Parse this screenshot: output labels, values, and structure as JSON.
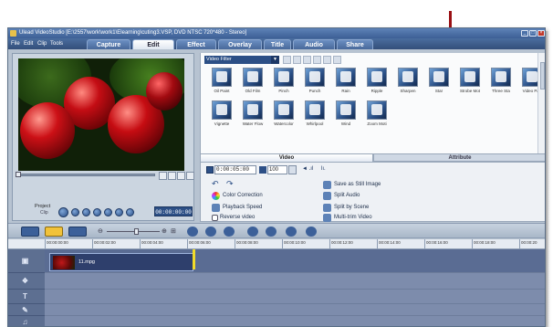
{
  "window": {
    "title": "Ulead VideoStudio [E:\\2557\\work\\work1\\Elearning\\cuting3.VSP, DVD NTSC 720*480 - Stereo]"
  },
  "menu": {
    "items": [
      "File",
      "Edit",
      "Clip",
      "Tools"
    ]
  },
  "steps": {
    "tabs": [
      "Capture",
      "Edit",
      "Effect",
      "Overlay",
      "Title",
      "Audio",
      "Share"
    ],
    "active": "Edit"
  },
  "preview": {
    "project_label": "Project",
    "clip_label": "Clip",
    "timecode": "00:00:00:00"
  },
  "library": {
    "dropdown_value": "Video Filter",
    "filters_row1": [
      "Oil Paint",
      "Old Film",
      "Pinch",
      "Punch",
      "Rain",
      "Ripple",
      "Sharpen",
      "Star",
      "Strobe Mot",
      "Three Sta",
      "Video Pan"
    ],
    "filters_row2": [
      "Vignette",
      "Water Flow",
      "Watercolor",
      "Whirlpool",
      "Wind",
      "Zoom Moti"
    ]
  },
  "options": {
    "tabs": [
      "Video",
      "Attribute"
    ],
    "duration": "0:00:05:00",
    "volume": "100",
    "left_items": [
      "Color Correction",
      "Playback Speed",
      "Reverse video"
    ],
    "right_items": [
      "Save as Still Image",
      "Split Audio",
      "Split by Scene",
      "Multi-trim Video"
    ]
  },
  "timeline": {
    "ruler_ticks": [
      "00:00:00:00",
      "00:00:02:00",
      "00:00:04:00",
      "00:00:06:00",
      "00:00:08:00",
      "00:00:10:00",
      "00:00:12:00",
      "00:00:14:00",
      "00:00:16:00",
      "00:00:18:00",
      "00:00:20"
    ],
    "clip_name": "11.mpg"
  }
}
